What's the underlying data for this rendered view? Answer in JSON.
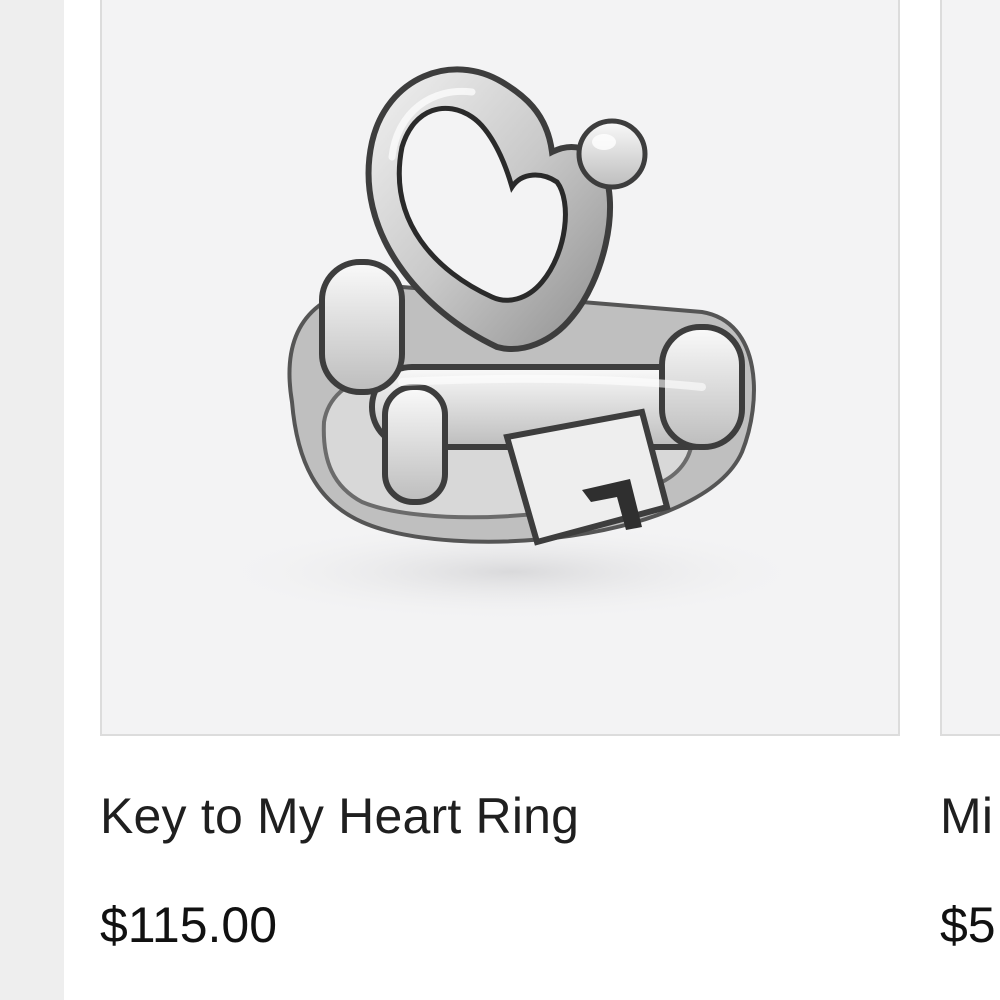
{
  "products": [
    {
      "name": "Key to My Heart Ring",
      "price": "$115.00",
      "image_subject": "sterling silver ring with heart-shaped key"
    },
    {
      "name": "Mi",
      "price": "$5"
    }
  ],
  "colors": {
    "page_background": "#ffffff",
    "gutter": "#eeeeee",
    "image_background": "#f3f3f4",
    "image_border": "#dcdcdc",
    "text": "#1f1f1f"
  }
}
